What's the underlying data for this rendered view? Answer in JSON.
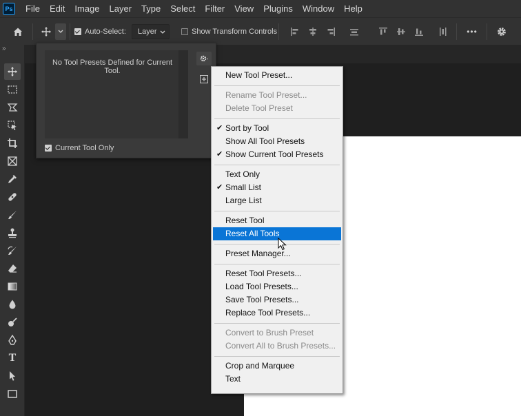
{
  "app": {
    "logo_text": "Ps"
  },
  "menubar": {
    "items": [
      "File",
      "Edit",
      "Image",
      "Layer",
      "Type",
      "Select",
      "Filter",
      "View",
      "Plugins",
      "Window",
      "Help"
    ]
  },
  "options": {
    "auto_select_label": "Auto-Select:",
    "auto_select_checked": true,
    "layer_dropdown": "Layer",
    "show_transform_label": "Show Transform Controls",
    "show_transform_checked": false,
    "more_label": "•••"
  },
  "tool_preset_panel": {
    "empty_message": "No Tool Presets Defined for Current Tool.",
    "current_tool_only_label": "Current Tool Only",
    "current_tool_only_checked": true
  },
  "context_menu": {
    "groups": [
      [
        {
          "label": "New Tool Preset...",
          "enabled": true,
          "checked": false
        }
      ],
      [
        {
          "label": "Rename Tool Preset...",
          "enabled": false,
          "checked": false
        },
        {
          "label": "Delete Tool Preset",
          "enabled": false,
          "checked": false
        }
      ],
      [
        {
          "label": "Sort by Tool",
          "enabled": true,
          "checked": true
        },
        {
          "label": "Show All Tool Presets",
          "enabled": true,
          "checked": false
        },
        {
          "label": "Show Current Tool Presets",
          "enabled": true,
          "checked": true
        }
      ],
      [
        {
          "label": "Text Only",
          "enabled": true,
          "checked": false
        },
        {
          "label": "Small List",
          "enabled": true,
          "checked": true
        },
        {
          "label": "Large List",
          "enabled": true,
          "checked": false
        }
      ],
      [
        {
          "label": "Reset Tool",
          "enabled": true,
          "checked": false
        },
        {
          "label": "Reset All Tools",
          "enabled": true,
          "checked": false,
          "highlighted": true
        }
      ],
      [
        {
          "label": "Preset Manager...",
          "enabled": true,
          "checked": false
        }
      ],
      [
        {
          "label": "Reset Tool Presets...",
          "enabled": true,
          "checked": false
        },
        {
          "label": "Load Tool Presets...",
          "enabled": true,
          "checked": false
        },
        {
          "label": "Save Tool Presets...",
          "enabled": true,
          "checked": false
        },
        {
          "label": "Replace Tool Presets...",
          "enabled": true,
          "checked": false
        }
      ],
      [
        {
          "label": "Convert to Brush Preset",
          "enabled": false,
          "checked": false
        },
        {
          "label": "Convert All to Brush Presets...",
          "enabled": false,
          "checked": false
        }
      ],
      [
        {
          "label": "Crop and Marquee",
          "enabled": true,
          "checked": false
        },
        {
          "label": "Text",
          "enabled": true,
          "checked": false
        }
      ]
    ]
  },
  "toolbar": {
    "tools": [
      "move-tool",
      "marquee-tool",
      "lasso-tool",
      "object-select-tool",
      "crop-tool",
      "frame-tool",
      "eyedropper-tool",
      "healing-brush-tool",
      "brush-tool",
      "clone-stamp-tool",
      "history-brush-tool",
      "eraser-tool",
      "gradient-tool",
      "blur-tool",
      "dodge-tool",
      "pen-tool",
      "type-tool",
      "path-select-tool",
      "rectangle-tool"
    ],
    "type_tool_glyph": "T"
  },
  "colors": {
    "highlight": "#0a75d6",
    "ui_dark": "#323232",
    "canvas": "#ffffff"
  }
}
